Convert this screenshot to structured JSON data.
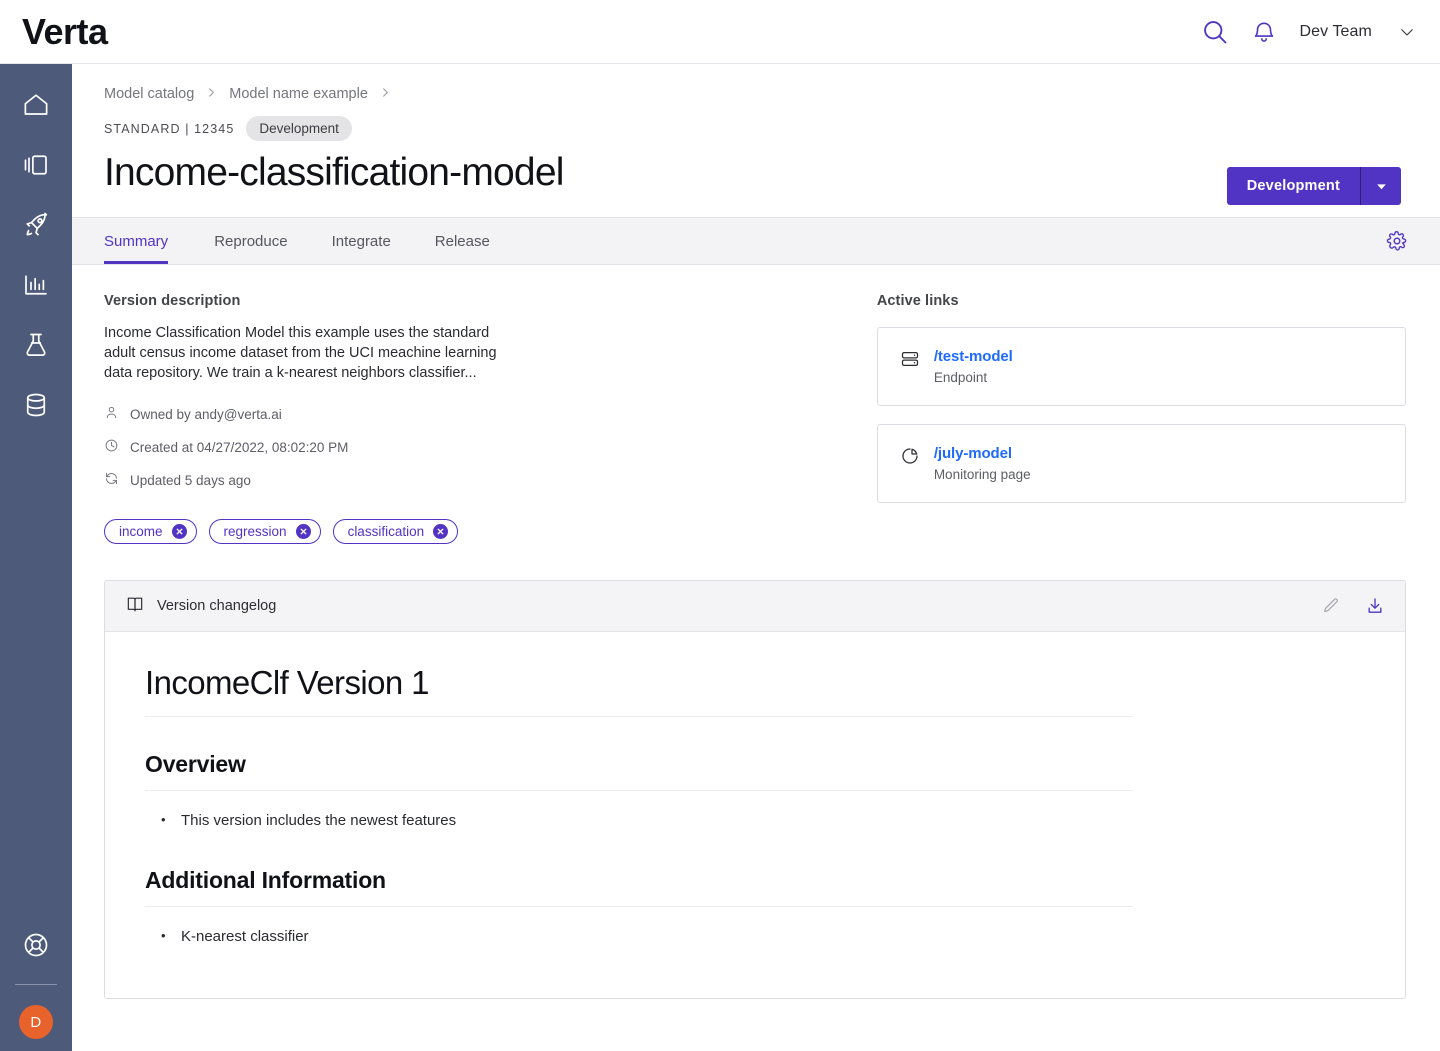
{
  "brand": {
    "logo_text": "Verta",
    "accent": "#5134c4",
    "sidebar_bg": "#4e5a7a",
    "link_blue": "#1f6bff",
    "avatar_bg": "#e8622c"
  },
  "topbar": {
    "search_icon": "search-icon",
    "bell_icon": "bell-icon",
    "team_name": "Dev Team",
    "caret_icon": "chevron-down-icon"
  },
  "sidebar": {
    "items": [
      {
        "icon": "home-icon",
        "name": "home"
      },
      {
        "icon": "catalog-icon",
        "name": "catalog"
      },
      {
        "icon": "rocket-icon",
        "name": "deployments"
      },
      {
        "icon": "chart-icon",
        "name": "monitoring"
      },
      {
        "icon": "flask-icon",
        "name": "experiments"
      },
      {
        "icon": "database-icon",
        "name": "datasets"
      }
    ],
    "support_icon": "lifebuoy-icon",
    "avatar_initial": "D"
  },
  "breadcrumb": {
    "items": [
      "Model catalog",
      "Model name example"
    ],
    "separator": "›"
  },
  "header": {
    "standard_label": "STANDARD | 12345",
    "env_badge": "Development",
    "title": "Income-classification-model",
    "env_button_label": "Development"
  },
  "tabs": [
    {
      "label": "Summary",
      "active": true
    },
    {
      "label": "Reproduce",
      "active": false
    },
    {
      "label": "Integrate",
      "active": false
    },
    {
      "label": "Release",
      "active": false
    }
  ],
  "tabbar": {
    "settings_icon": "gear-icon"
  },
  "summary": {
    "description_label": "Version description",
    "description_text": "Income Classification Model this example uses the standard adult census income dataset from the UCI meachine learning data repository. We train a k-nearest neighbors classifier...",
    "meta": [
      {
        "icon": "user-icon",
        "text": "Owned by andy@verta.ai"
      },
      {
        "icon": "clock-icon",
        "text": "Created at 04/27/2022, 08:02:20 PM"
      },
      {
        "icon": "refresh-icon",
        "text": "Updated 5 days ago"
      }
    ],
    "tags": [
      "income",
      "regression",
      "classification"
    ]
  },
  "active_links": {
    "label": "Active links",
    "cards": [
      {
        "icon": "server-icon",
        "title": "/test-model",
        "subtitle": "Endpoint"
      },
      {
        "icon": "pie-chart-icon",
        "title": "/july-model",
        "subtitle": "Monitoring page"
      }
    ]
  },
  "changelog": {
    "panel_icon": "book-icon",
    "panel_title": "Version changelog",
    "edit_icon": "pencil-icon",
    "download_icon": "download-icon",
    "h1": "IncomeClf Version 1",
    "sections": [
      {
        "heading": "Overview",
        "bullets": [
          "This version includes the newest features"
        ]
      },
      {
        "heading": "Additional Information",
        "bullets": [
          "K-nearest classifier"
        ]
      }
    ]
  }
}
